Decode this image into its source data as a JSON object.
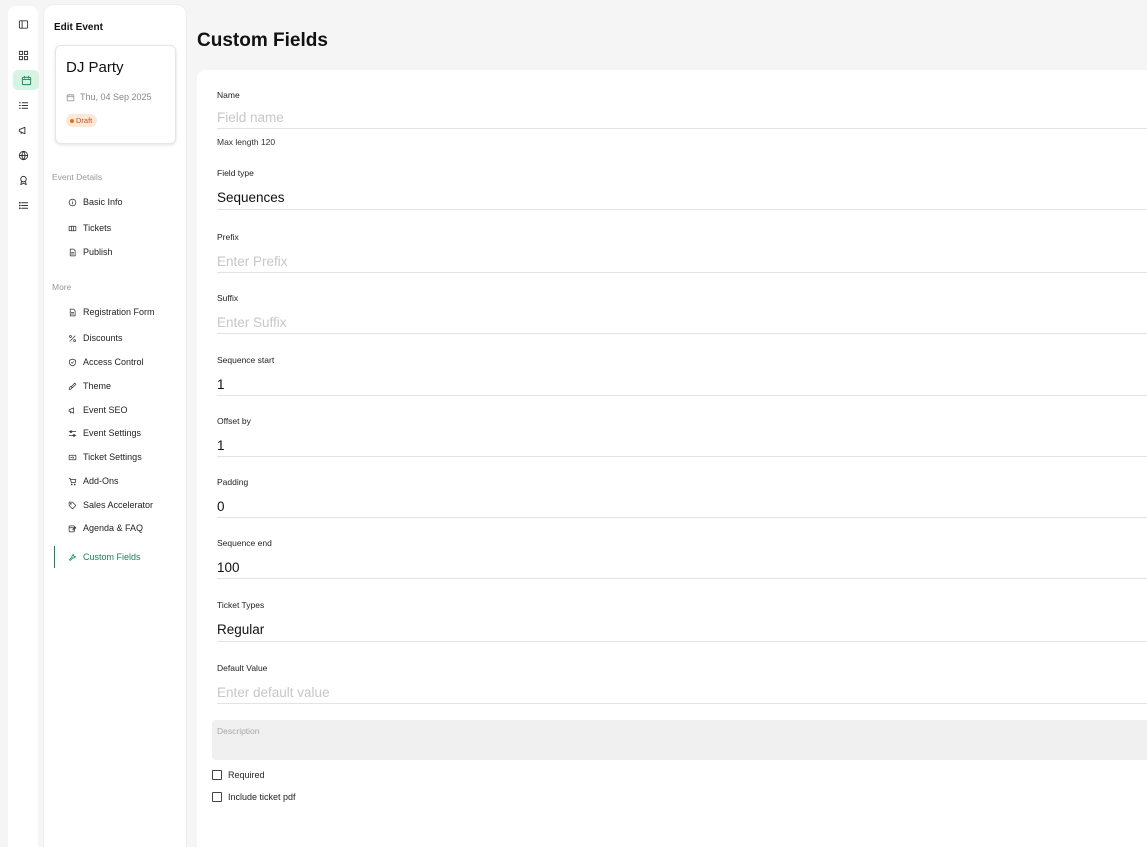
{
  "sidebar": {
    "title": "Edit Event",
    "event": {
      "name": "DJ Party",
      "date": "Thu, 04 Sep 2025",
      "status": "Draft",
      "status_color": "#e07020"
    },
    "sections": [
      {
        "heading": "Event Details",
        "items": [
          "Basic Info",
          "Tickets",
          "Publish"
        ]
      },
      {
        "heading": "More",
        "items": [
          "Registration Form",
          "Discounts",
          "Access Control",
          "Theme",
          "Event SEO",
          "Event Settings",
          "Ticket Settings",
          "Add-Ons",
          "Sales Accelerator",
          "Agenda & FAQ",
          "Custom Fields"
        ]
      }
    ],
    "active_item": "Custom Fields",
    "accent_color": "#0d8a52"
  },
  "main": {
    "title": "Custom Fields",
    "fields": {
      "name": {
        "label": "Name",
        "value": "",
        "placeholder": "Field name",
        "hint": "Max length 120"
      },
      "field_type": {
        "label": "Field type",
        "value": "Sequences"
      },
      "prefix": {
        "label": "Prefix",
        "value": "",
        "placeholder": "Enter Prefix"
      },
      "suffix": {
        "label": "Suffix",
        "value": "",
        "placeholder": "Enter Suffix"
      },
      "sequence_start": {
        "label": "Sequence start",
        "value": "1"
      },
      "offset_by": {
        "label": "Offset by",
        "value": "1"
      },
      "padding": {
        "label": "Padding",
        "value": "0"
      },
      "sequence_end": {
        "label": "Sequence end",
        "value": "100"
      },
      "ticket_types": {
        "label": "Ticket Types",
        "value": "Regular"
      },
      "default_value": {
        "label": "Default Value",
        "value": "",
        "placeholder": "Enter default value"
      },
      "description": {
        "placeholder": "Description"
      }
    },
    "checkboxes": {
      "required": "Required",
      "include_ticket_pdf": "Include ticket pdf"
    }
  }
}
